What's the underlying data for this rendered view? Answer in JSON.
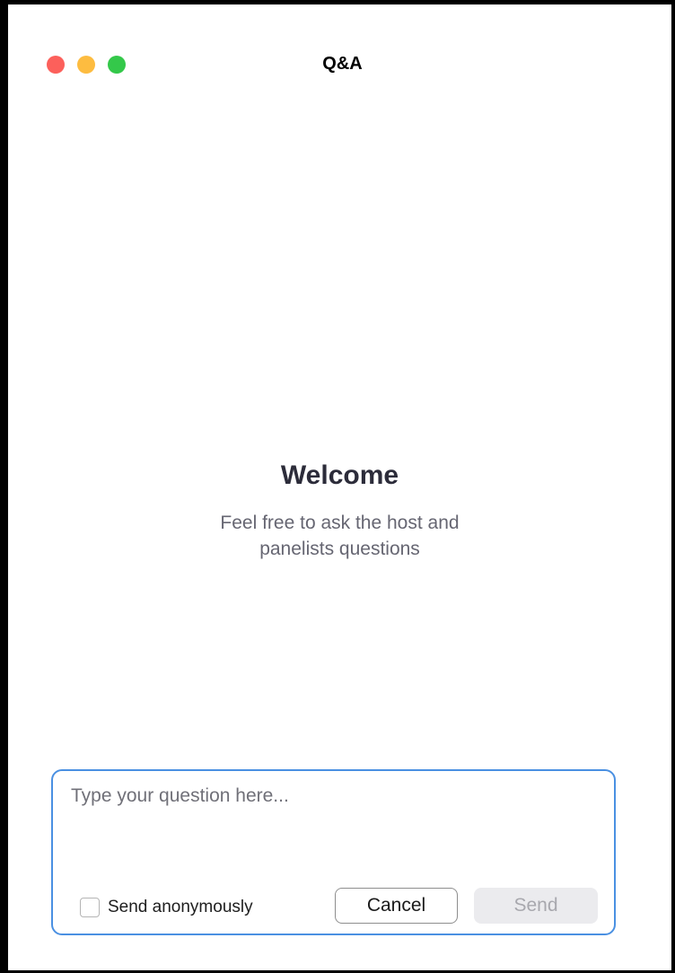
{
  "window": {
    "title": "Q&A",
    "traffic_lights": {
      "close_color": "#fc605b",
      "minimize_color": "#fdbc40",
      "zoom_color": "#34c84a"
    }
  },
  "empty_state": {
    "heading": "Welcome",
    "message_line1": "Feel free to ask the host and",
    "message_line2": "panelists questions"
  },
  "composer": {
    "placeholder": "Type your question here...",
    "value": "",
    "anonymous_label": "Send anonymously",
    "anonymous_checked": false,
    "cancel_label": "Cancel",
    "send_label": "Send",
    "send_enabled": false,
    "accent_color": "#4a90e2"
  }
}
